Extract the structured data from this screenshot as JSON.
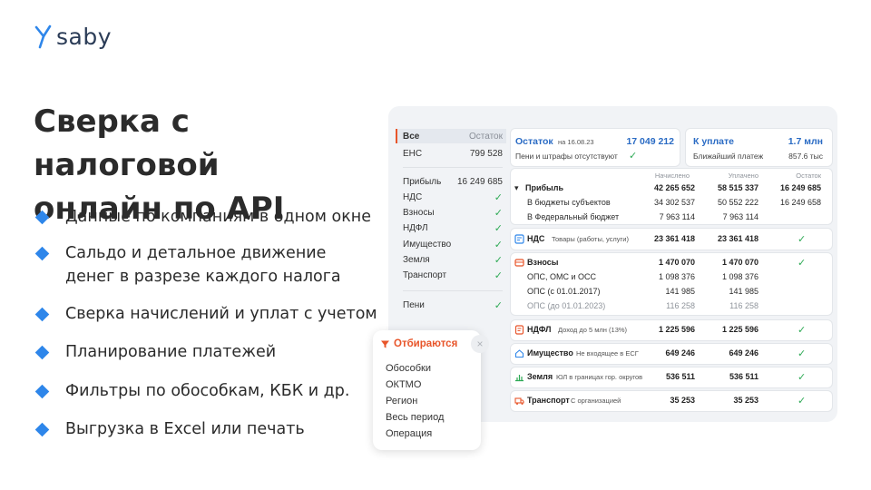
{
  "brand": {
    "name": "saby"
  },
  "headline": {
    "line1": "Сверка с налоговой",
    "line2": "онлайн по API"
  },
  "bullets": [
    {
      "line1": "Данные по компаниям в одном окне"
    },
    {
      "line1": "Сальдо и детальное движение",
      "line2": "денег в разрезе каждого налога"
    },
    {
      "line1": "Сверка начислений и уплат с учетом"
    },
    {
      "line1": "Планирование платежей"
    },
    {
      "line1": "Фильтры по обособкам, КБК и др."
    },
    {
      "line1": "Выгрузка в Excel или печать"
    }
  ],
  "colors": {
    "accent": "#2e86ea",
    "orange": "#e8552a",
    "check": "#2eaa55",
    "title_blue": "#2a6bc4"
  },
  "sidebar": {
    "head_label": "Все",
    "head_right": "Остаток",
    "ens_label": "ЕНС",
    "ens_value": "799 528",
    "items": [
      {
        "label": "Прибыль",
        "value": "16 249 685"
      },
      {
        "label": "НДС",
        "value": "✓"
      },
      {
        "label": "Взносы",
        "value": "✓"
      },
      {
        "label": "НДФЛ",
        "value": "✓"
      },
      {
        "label": "Имущество",
        "value": "✓"
      },
      {
        "label": "Земля",
        "value": "✓"
      },
      {
        "label": "Транспорт",
        "value": "✓"
      }
    ],
    "peni_label": "Пени",
    "peni_value": "✓"
  },
  "balance_card": {
    "title": "Остаток",
    "date": "на 16.08.23",
    "amount": "17 049 212",
    "note": "Пени и штрафы отсутствуют",
    "note_check": "✓"
  },
  "pay_card": {
    "title": "К уплате",
    "amount": "1.7 млн",
    "note": "Ближайший платеж",
    "note_amount": "857.6 тыс"
  },
  "columns": {
    "accrued": "Начислено",
    "paid": "Уплачено",
    "balance": "Остаток"
  },
  "profit": {
    "label": "Прибыль",
    "accrued": "42 265 652",
    "paid": "58 515 337",
    "balance": "16 249 685",
    "rows": [
      {
        "label": "В бюджеты субъектов",
        "accrued": "34 302 537",
        "paid": "50 552 222",
        "balance": "16 249 658"
      },
      {
        "label": "В Федеральный бюджет",
        "accrued": "7 963 114",
        "paid": "7 963 114",
        "balance": ""
      }
    ]
  },
  "nds": {
    "label": "НДС",
    "sub": "Товары (работы, услуги)",
    "accrued": "23 361 418",
    "paid": "23 361 418",
    "status": "✓"
  },
  "vznosy": {
    "label": "Взносы",
    "accrued": "1 470 070",
    "paid": "1 470 070",
    "status": "✓",
    "rows": [
      {
        "label": "ОПС, ОМС и ОСС",
        "accrued": "1 098 376",
        "paid": "1 098 376"
      },
      {
        "label": "ОПС (с 01.01.2017)",
        "accrued": "141 985",
        "paid": "141 985"
      },
      {
        "label": "ОПС (до 01.01.2023)",
        "accrued": "116 258",
        "paid": "116 258"
      }
    ]
  },
  "ndfl": {
    "label": "НДФЛ",
    "sub": "Доход до 5 млн (13%)",
    "accrued": "1 225 596",
    "paid": "1 225 596",
    "status": "✓"
  },
  "imush": {
    "label": "Имущество",
    "sub": "Не входящее в ЕСГ",
    "accrued": "649 246",
    "paid": "649 246",
    "status": "✓"
  },
  "zemlya": {
    "label": "Земля",
    "sub": "ЮЛ в границах гор. округов",
    "accrued": "536 511",
    "paid": "536 511",
    "status": "✓"
  },
  "transport": {
    "label": "Транспорт",
    "sub": "С организацией",
    "accrued": "35 253",
    "paid": "35 253",
    "status": "✓"
  },
  "filter": {
    "title": "Отбираются",
    "close": "×",
    "items": [
      "Обособки",
      "ОКТМО",
      "Регион",
      "Весь период",
      "Операция"
    ]
  }
}
